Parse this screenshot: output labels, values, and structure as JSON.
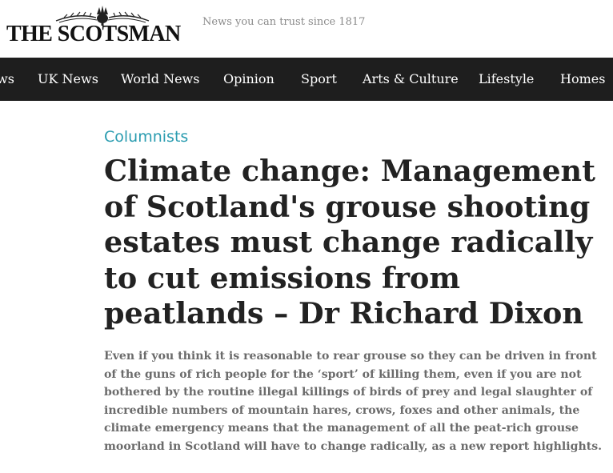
{
  "masthead": {
    "logo_text": "THE SCOTSMAN",
    "logo_crest_icon": "thistle-crest-icon",
    "tagline": "News you can trust since 1817"
  },
  "nav": {
    "items": [
      {
        "label": "ws"
      },
      {
        "label": "UK News"
      },
      {
        "label": "World News"
      },
      {
        "label": "Opinion"
      },
      {
        "label": "Sport"
      },
      {
        "label": "Arts & Culture"
      },
      {
        "label": "Lifestyle"
      },
      {
        "label": "Homes"
      }
    ]
  },
  "article": {
    "section": "Columnists",
    "headline_lines": [
      "Climate change: Management",
      "of Scotland's grouse shooting",
      "estates must change radically",
      "to cut emissions from",
      "peatlands – Dr Richard Dixon"
    ],
    "standfirst_lines": [
      "Even if you think it is reasonable to rear grouse so they can be driven in front",
      "of the guns of rich people for the ‘sport’ of killing them, even if you are not",
      "bothered by the routine illegal killings of birds of prey and legal slaughter of",
      "incredible numbers of mountain hares, crows, foxes and other animals, the",
      "climate emergency means that the management of all the peat-rich grouse",
      "moorland in Scotland will have to change radically, as a new report highlights."
    ]
  },
  "colors": {
    "nav_background": "#1e1e1e",
    "section_accent": "#2a9cb0",
    "headline": "#222222",
    "standfirst": "#6b6b6b"
  }
}
